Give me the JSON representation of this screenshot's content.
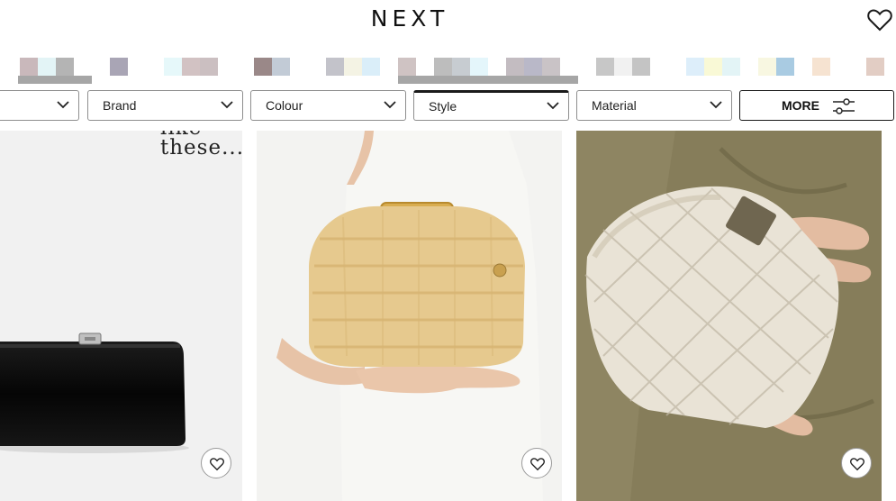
{
  "header": {
    "logo": "NEXT",
    "favourites_icon": "heart-icon"
  },
  "filters": [
    {
      "label": "",
      "active": false
    },
    {
      "label": "Brand",
      "active": false
    },
    {
      "label": "Colour",
      "active": false
    },
    {
      "label": "Style",
      "active": true
    },
    {
      "label": "Material",
      "active": false
    }
  ],
  "more_button": {
    "label": "MORE",
    "icon": "sliders-icon"
  },
  "products": [
    {
      "promo_lines": [
        "like",
        "these..."
      ],
      "item": "black clutch bag",
      "favourite_icon": "heart-icon"
    },
    {
      "item": "natural raffia frame clutch bag",
      "favourite_icon": "heart-icon"
    },
    {
      "item": "cream macrame clutch bag",
      "favourite_icon": "heart-icon"
    }
  ],
  "colors": {
    "text": "#222222",
    "border": "#8e8e8e",
    "active_border": "#1a1a1a",
    "raffia": "#e6c98e",
    "macrame": "#e9e3d6",
    "olive_dress": "#8e8562"
  }
}
